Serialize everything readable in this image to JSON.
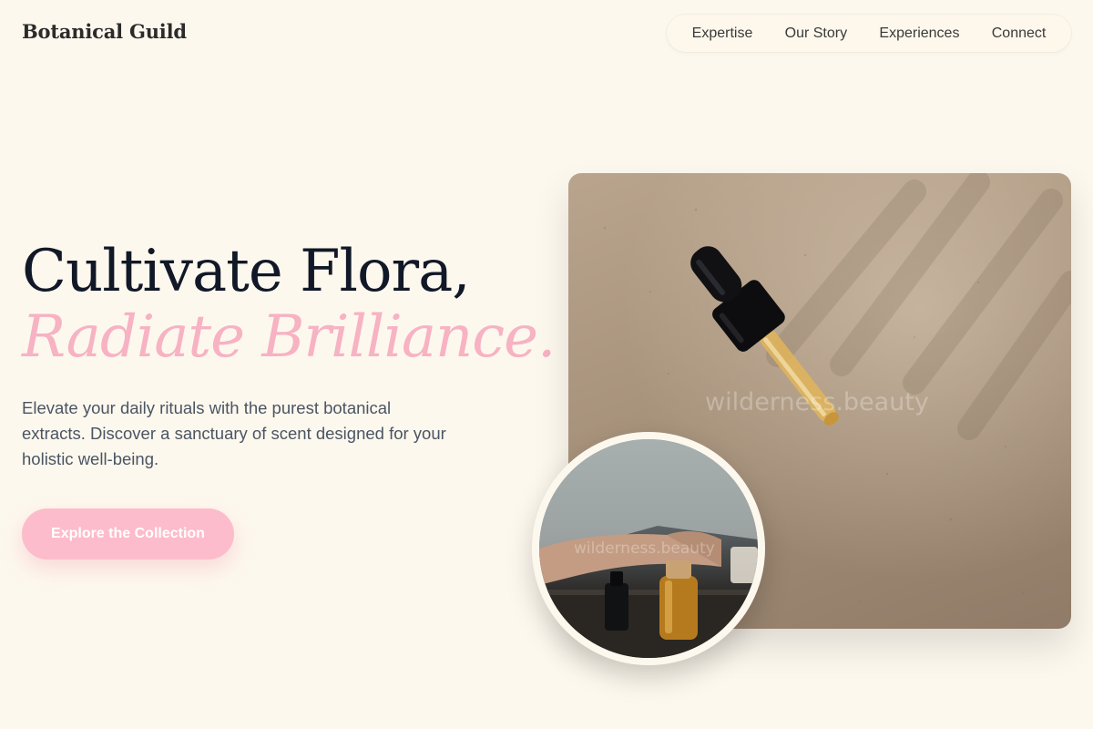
{
  "header": {
    "logo": "Botanical Guild",
    "nav": [
      {
        "label": "Expertise"
      },
      {
        "label": "Our Story"
      },
      {
        "label": "Experiences"
      },
      {
        "label": "Connect"
      }
    ]
  },
  "hero": {
    "title_line1": "Cultivate Flora,",
    "title_line2": "Radiate Brilliance.",
    "subtitle": "Elevate your daily rituals with the purest botanical extracts. Discover a sanctuary of scent designed for your holistic well-being.",
    "cta_label": "Explore the Collection"
  },
  "images": {
    "main_watermark": "wilderness.beauty",
    "circle_watermark": "wilderness.beauty"
  },
  "colors": {
    "background": "#fdf8ee",
    "accent_pink": "#f7b2c3",
    "button_pink": "#fdbccb",
    "heading": "#111827"
  }
}
